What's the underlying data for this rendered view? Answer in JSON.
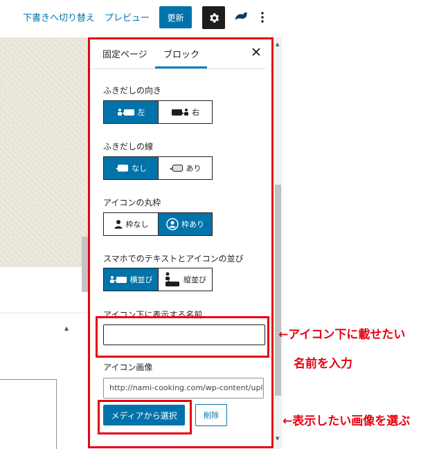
{
  "toolbar": {
    "switch_to_draft": "下書きへ切り替え",
    "preview": "プレビュー",
    "update": "更新",
    "settings_icon": "gear-icon",
    "plugin_icon": "swell-logo-icon",
    "more_icon": "vertical-ellipsis-icon"
  },
  "sidebar": {
    "tabs": [
      {
        "label": "固定ページ",
        "active": false
      },
      {
        "label": "ブロック",
        "active": true
      }
    ],
    "close_icon": "close-icon",
    "direction": {
      "label": "ふきだしの向き",
      "options": [
        {
          "label": "左",
          "selected": true
        },
        {
          "label": "右",
          "selected": false
        }
      ]
    },
    "border": {
      "label": "ふきだしの線",
      "options": [
        {
          "label": "なし",
          "selected": true
        },
        {
          "label": "あり",
          "selected": false
        }
      ]
    },
    "icon_frame": {
      "label": "アイコンの丸枠",
      "options": [
        {
          "label": "枠なし",
          "selected": false
        },
        {
          "label": "枠あり",
          "selected": true
        }
      ]
    },
    "mobile_layout": {
      "label": "スマホでのテキストとアイコンの並び",
      "options": [
        {
          "label": "横並び",
          "selected": true
        },
        {
          "label": "縦並び",
          "selected": false
        }
      ]
    },
    "icon_name": {
      "label": "アイコン下に表示する名前",
      "value": ""
    },
    "icon_image": {
      "label": "アイコン画像",
      "url": "http://nami-cooking.com/wp-content/uploads/",
      "select_button": "メディアから選択",
      "delete_button": "削除"
    }
  },
  "annotations": {
    "name_hint_line1": "←アイコン下に載せたい",
    "name_hint_line2": "名前を入力",
    "image_hint": "←表示したい画像を選ぶ",
    "highlight_color": "#e60012"
  },
  "colors": {
    "accent": "#0073aa",
    "text": "#1e1e1e"
  }
}
